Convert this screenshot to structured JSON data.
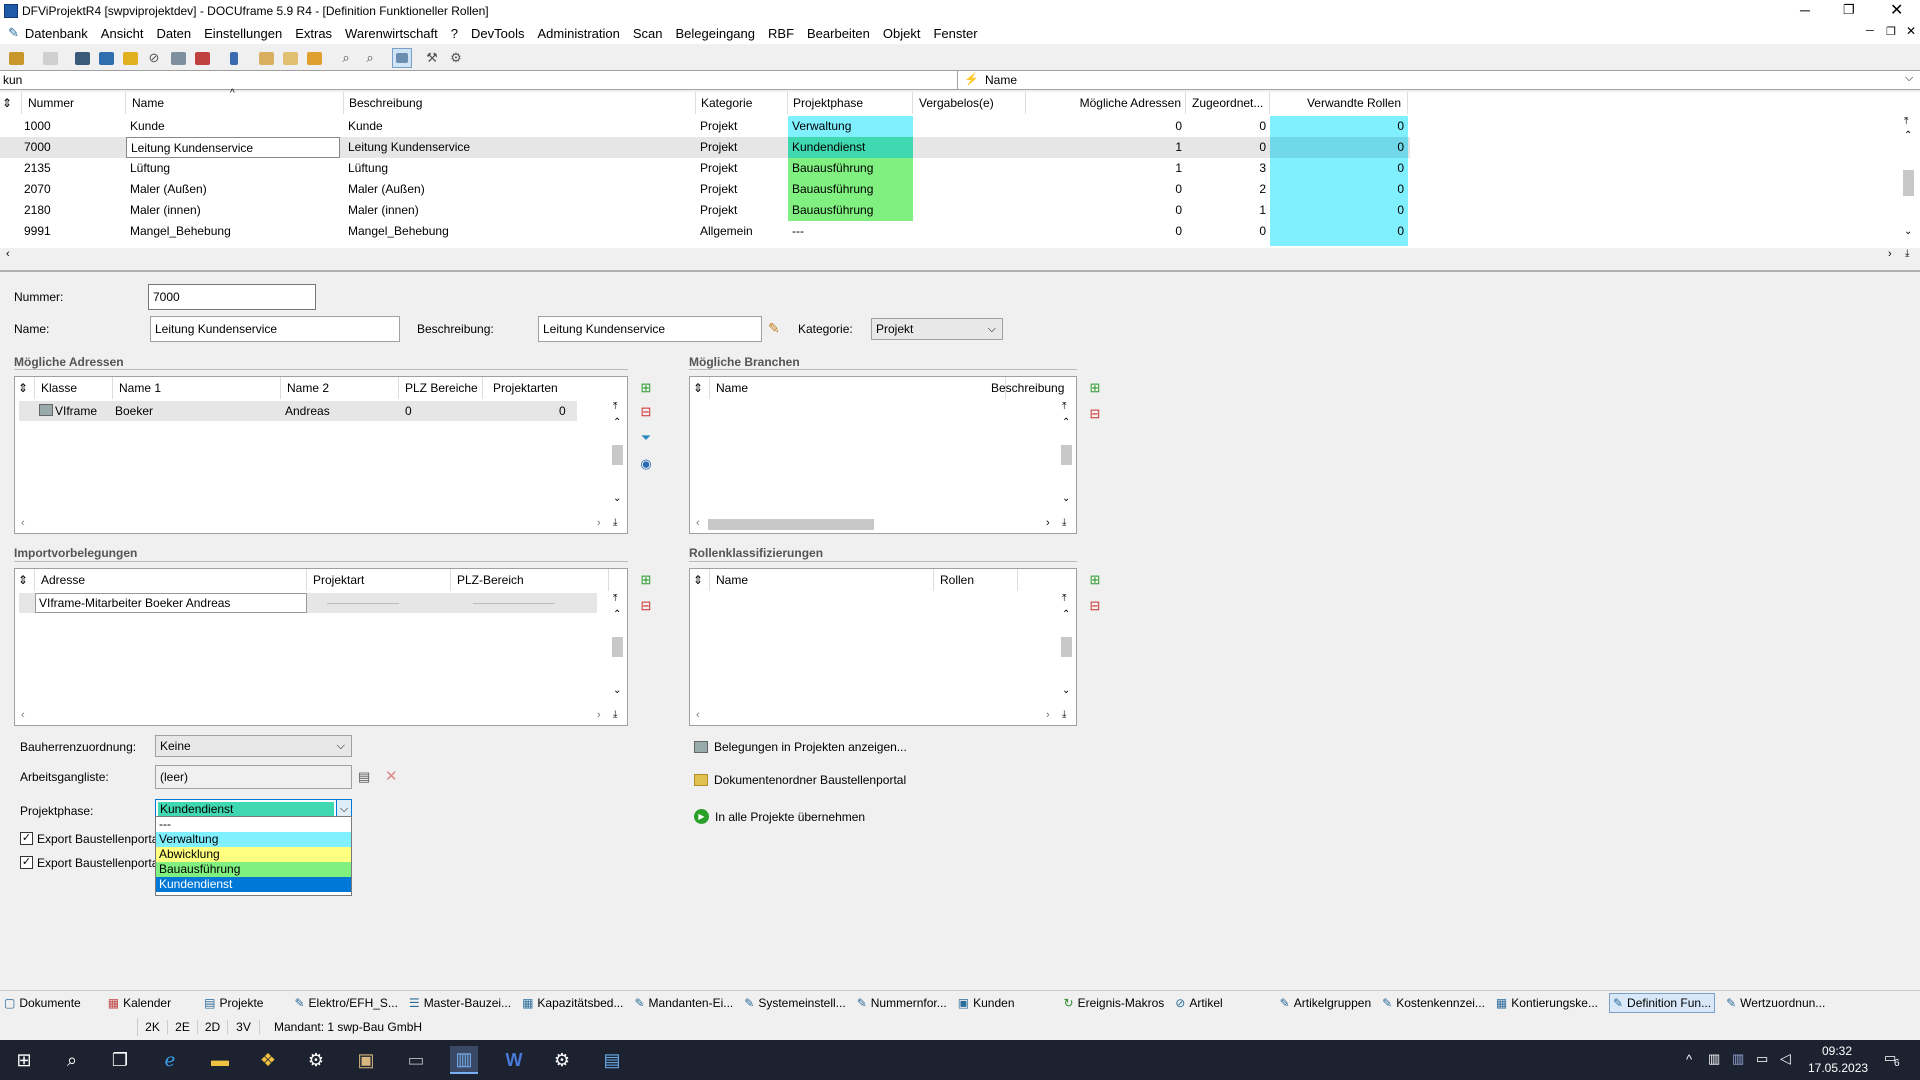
{
  "window": {
    "title": "DFViProjektR4 [swpviprojektdev] - DOCUframe 5.9 R4 - [Definition Funktioneller Rollen]"
  },
  "menu": [
    "Datenbank",
    "Ansicht",
    "Daten",
    "Einstellungen",
    "Extras",
    "Warenwirtschaft",
    "?",
    "DevTools",
    "Administration",
    "Scan",
    "Belegeingang",
    "RBF",
    "Bearbeiten",
    "Objekt",
    "Fenster"
  ],
  "search": {
    "value": "kun",
    "field_label": "Name"
  },
  "grid": {
    "headers": [
      "Nummer",
      "Name",
      "Beschreibung",
      "Kategorie",
      "Projektphase",
      "Vergabelos(e)",
      "Mögliche Adressen",
      "Zugeordnet...",
      "Verwandte Rollen"
    ],
    "rows": [
      {
        "nummer": "1000",
        "name": "Kunde",
        "beschreibung": "Kunde",
        "kategorie": "Projekt",
        "phase": "Verwaltung",
        "vergabe": "",
        "adressen": "0",
        "zugeordnet": "0",
        "rollen": "0"
      },
      {
        "nummer": "7000",
        "name": "Leitung Kundenservice",
        "beschreibung": "Leitung Kundenservice",
        "kategorie": "Projekt",
        "phase": "Kundendienst",
        "vergabe": "",
        "adressen": "1",
        "zugeordnet": "0",
        "rollen": "0"
      },
      {
        "nummer": "2135",
        "name": "Lüftung",
        "beschreibung": "Lüftung",
        "kategorie": "Projekt",
        "phase": "Bauausführung",
        "vergabe": "",
        "adressen": "1",
        "zugeordnet": "3",
        "rollen": "0"
      },
      {
        "nummer": "2070",
        "name": "Maler (Außen)",
        "beschreibung": "Maler (Außen)",
        "kategorie": "Projekt",
        "phase": "Bauausführung",
        "vergabe": "",
        "adressen": "0",
        "zugeordnet": "2",
        "rollen": "0"
      },
      {
        "nummer": "2180",
        "name": "Maler (innen)",
        "beschreibung": "Maler (innen)",
        "kategorie": "Projekt",
        "phase": "Bauausführung",
        "vergabe": "",
        "adressen": "0",
        "zugeordnet": "1",
        "rollen": "0"
      },
      {
        "nummer": "9991",
        "name": "Mangel_Behebung",
        "beschreibung": "Mangel_Behebung",
        "kategorie": "Allgemein",
        "phase": "---",
        "vergabe": "",
        "adressen": "0",
        "zugeordnet": "0",
        "rollen": "0"
      }
    ]
  },
  "form": {
    "nummer_label": "Nummer:",
    "nummer": "7000",
    "name_label": "Name:",
    "name": "Leitung Kundenservice",
    "beschreibung_label": "Beschreibung:",
    "beschreibung": "Leitung Kundenservice",
    "kategorie_label": "Kategorie:",
    "kategorie": "Projekt"
  },
  "adressen": {
    "title": "Mögliche Adressen",
    "headers": [
      "Klasse",
      "Name 1",
      "Name 2",
      "PLZ Bereiche",
      "Projektarten"
    ],
    "row": {
      "klasse": "VIframe-M",
      "name1": "Boeker",
      "name2": "Andreas",
      "plz": "0",
      "arten": "0"
    }
  },
  "branchen": {
    "title": "Mögliche Branchen",
    "headers": [
      "Name",
      "Beschreibung"
    ]
  },
  "import": {
    "title": "Importvorbelegungen",
    "headers": [
      "Adresse",
      "Projektart",
      "PLZ-Bereich"
    ],
    "row": {
      "adresse": "VIframe-Mitarbeiter Boeker Andreas"
    }
  },
  "klass": {
    "title": "Rollenklassifizierungen",
    "headers": [
      "Name",
      "Rollen"
    ]
  },
  "lower": {
    "bauherr_label": "Bauherrenzuordnung:",
    "bauherr": "Keine",
    "arbeit_label": "Arbeitsgangliste:",
    "arbeit": "(leer)",
    "phase_label": "Projektphase:",
    "phase": "Kundendienst",
    "export1": "Export Baustellenporta",
    "export2": "Export Baustellenporta"
  },
  "dropdown": [
    "---",
    "Verwaltung",
    "Abwicklung",
    "Bauausführung",
    "Kundendienst"
  ],
  "actions": [
    "Belegungen in Projekten anzeigen...",
    "Dokumentenordner Baustellenportal",
    "In alle Projekte übernehmen"
  ],
  "tabs": [
    "Dokumente",
    "Kalender",
    "Projekte",
    "Elektro/EFH_S...",
    "Master-Bauzei...",
    "Kapazitätsbed...",
    "Mandanten-Ei...",
    "Systemeinstell...",
    "Nummernfor...",
    "Kunden",
    "Ereignis-Makros",
    "Artikel",
    "Artikelgruppen",
    "Kostenkennzei...",
    "Kontierungske...",
    "Definition Fun...",
    "Wertzuordnun..."
  ],
  "status": {
    "b1": "2K",
    "b2": "2E",
    "b3": "2D",
    "b4": "3V",
    "mandant": "Mandant: 1 swp-Bau GmbH"
  },
  "clock": {
    "time": "09:32",
    "date": "17.05.2023",
    "badge": "6"
  },
  "colors": {
    "verwaltung": "#80f0ff",
    "kundendienst": "#40d8b0",
    "bauausfuehrung": "#80f080",
    "abwicklung": "#ffff80",
    "selected": "#0078d7"
  }
}
